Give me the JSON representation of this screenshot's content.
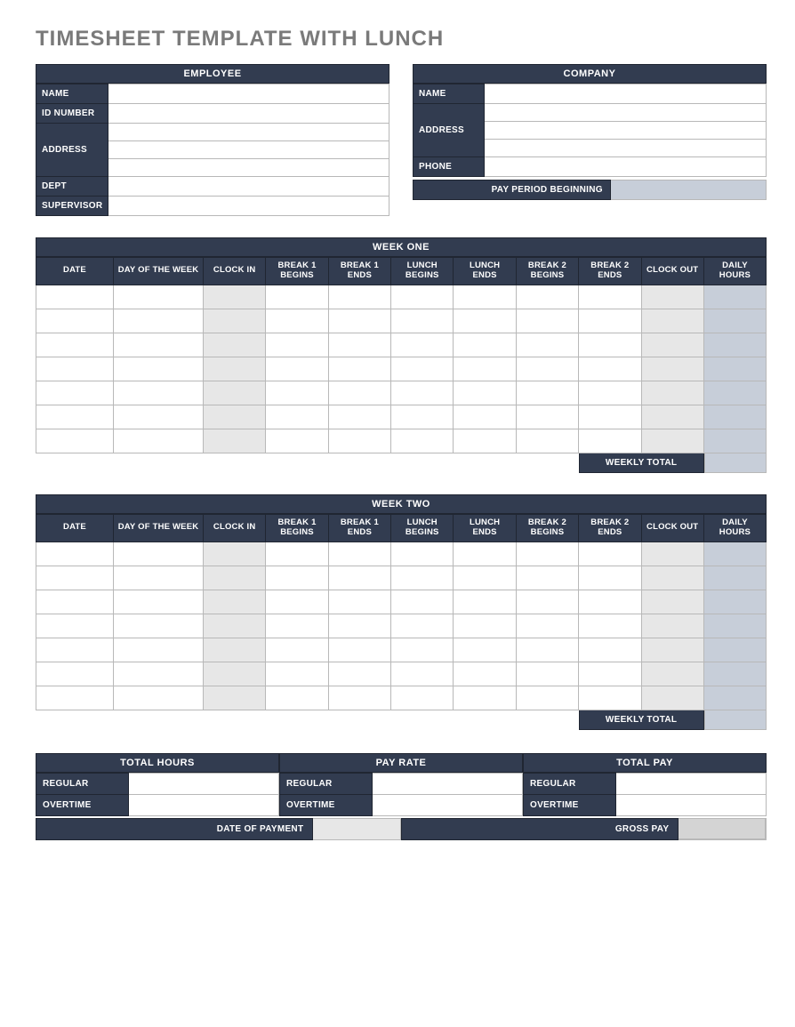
{
  "title": "TIMESHEET TEMPLATE WITH LUNCH",
  "employee": {
    "header": "EMPLOYEE",
    "labels": {
      "name": "NAME",
      "id": "ID NUMBER",
      "address": "ADDRESS",
      "dept": "DEPT",
      "supervisor": "SUPERVISOR"
    },
    "values": {
      "name": "",
      "id": "",
      "addr1": "",
      "addr2": "",
      "addr3": "",
      "dept": "",
      "supervisor": ""
    }
  },
  "company": {
    "header": "COMPANY",
    "labels": {
      "name": "NAME",
      "address": "ADDRESS",
      "phone": "PHONE"
    },
    "values": {
      "name": "",
      "addr1": "",
      "addr2": "",
      "addr3": "",
      "phone": ""
    }
  },
  "pay_period": {
    "label": "PAY PERIOD BEGINNING",
    "value": ""
  },
  "columns": {
    "date": "DATE",
    "dow": "DAY OF THE WEEK",
    "clock_in": "CLOCK IN",
    "b1b": "BREAK 1 BEGINS",
    "b1e": "BREAK 1 ENDS",
    "lb": "LUNCH BEGINS",
    "le": "LUNCH ENDS",
    "b2b": "BREAK 2 BEGINS",
    "b2e": "BREAK 2 ENDS",
    "clock_out": "CLOCK OUT",
    "daily": "DAILY HOURS"
  },
  "weeks": [
    {
      "header": "WEEK ONE",
      "weekly_total_label": "WEEKLY TOTAL",
      "weekly_total_value": "",
      "rows": [
        {
          "date": "",
          "dow": "",
          "clock_in": "",
          "b1b": "",
          "b1e": "",
          "lb": "",
          "le": "",
          "b2b": "",
          "b2e": "",
          "clock_out": "",
          "daily": ""
        },
        {
          "date": "",
          "dow": "",
          "clock_in": "",
          "b1b": "",
          "b1e": "",
          "lb": "",
          "le": "",
          "b2b": "",
          "b2e": "",
          "clock_out": "",
          "daily": ""
        },
        {
          "date": "",
          "dow": "",
          "clock_in": "",
          "b1b": "",
          "b1e": "",
          "lb": "",
          "le": "",
          "b2b": "",
          "b2e": "",
          "clock_out": "",
          "daily": ""
        },
        {
          "date": "",
          "dow": "",
          "clock_in": "",
          "b1b": "",
          "b1e": "",
          "lb": "",
          "le": "",
          "b2b": "",
          "b2e": "",
          "clock_out": "",
          "daily": ""
        },
        {
          "date": "",
          "dow": "",
          "clock_in": "",
          "b1b": "",
          "b1e": "",
          "lb": "",
          "le": "",
          "b2b": "",
          "b2e": "",
          "clock_out": "",
          "daily": ""
        },
        {
          "date": "",
          "dow": "",
          "clock_in": "",
          "b1b": "",
          "b1e": "",
          "lb": "",
          "le": "",
          "b2b": "",
          "b2e": "",
          "clock_out": "",
          "daily": ""
        },
        {
          "date": "",
          "dow": "",
          "clock_in": "",
          "b1b": "",
          "b1e": "",
          "lb": "",
          "le": "",
          "b2b": "",
          "b2e": "",
          "clock_out": "",
          "daily": ""
        }
      ]
    },
    {
      "header": "WEEK TWO",
      "weekly_total_label": "WEEKLY TOTAL",
      "weekly_total_value": "",
      "rows": [
        {
          "date": "",
          "dow": "",
          "clock_in": "",
          "b1b": "",
          "b1e": "",
          "lb": "",
          "le": "",
          "b2b": "",
          "b2e": "",
          "clock_out": "",
          "daily": ""
        },
        {
          "date": "",
          "dow": "",
          "clock_in": "",
          "b1b": "",
          "b1e": "",
          "lb": "",
          "le": "",
          "b2b": "",
          "b2e": "",
          "clock_out": "",
          "daily": ""
        },
        {
          "date": "",
          "dow": "",
          "clock_in": "",
          "b1b": "",
          "b1e": "",
          "lb": "",
          "le": "",
          "b2b": "",
          "b2e": "",
          "clock_out": "",
          "daily": ""
        },
        {
          "date": "",
          "dow": "",
          "clock_in": "",
          "b1b": "",
          "b1e": "",
          "lb": "",
          "le": "",
          "b2b": "",
          "b2e": "",
          "clock_out": "",
          "daily": ""
        },
        {
          "date": "",
          "dow": "",
          "clock_in": "",
          "b1b": "",
          "b1e": "",
          "lb": "",
          "le": "",
          "b2b": "",
          "b2e": "",
          "clock_out": "",
          "daily": ""
        },
        {
          "date": "",
          "dow": "",
          "clock_in": "",
          "b1b": "",
          "b1e": "",
          "lb": "",
          "le": "",
          "b2b": "",
          "b2e": "",
          "clock_out": "",
          "daily": ""
        },
        {
          "date": "",
          "dow": "",
          "clock_in": "",
          "b1b": "",
          "b1e": "",
          "lb": "",
          "le": "",
          "b2b": "",
          "b2e": "",
          "clock_out": "",
          "daily": ""
        }
      ]
    }
  ],
  "summary": {
    "hours": {
      "header": "TOTAL HOURS",
      "regular_label": "REGULAR",
      "overtime_label": "OVERTIME",
      "regular": "",
      "overtime": ""
    },
    "rate": {
      "header": "PAY RATE",
      "regular_label": "REGULAR",
      "overtime_label": "OVERTIME",
      "regular": "",
      "overtime": ""
    },
    "pay": {
      "header": "TOTAL PAY",
      "regular_label": "REGULAR",
      "overtime_label": "OVERTIME",
      "regular": "",
      "overtime": ""
    }
  },
  "footer": {
    "date_of_payment_label": "DATE OF PAYMENT",
    "date_of_payment": "",
    "gross_pay_label": "GROSS PAY",
    "gross_pay": ""
  }
}
